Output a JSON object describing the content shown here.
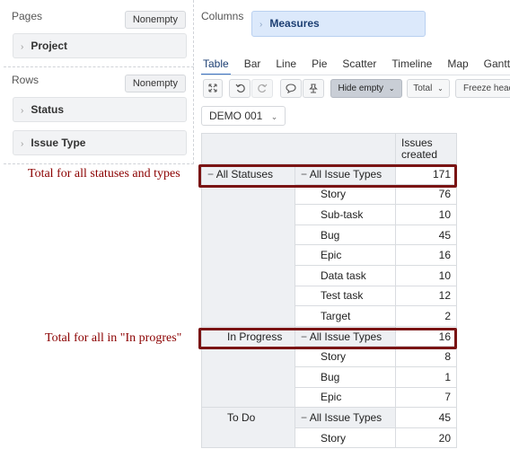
{
  "left": {
    "pages_label": "Pages",
    "pages_nonempty": "Nonempty",
    "pages_items": [
      "Project"
    ],
    "rows_label": "Rows",
    "rows_nonempty": "Nonempty",
    "rows_items": [
      "Status",
      "Issue Type"
    ]
  },
  "columns": {
    "label": "Columns",
    "measures": "Measures"
  },
  "tabs": [
    "Table",
    "Bar",
    "Line",
    "Pie",
    "Scatter",
    "Timeline",
    "Map",
    "Gantt"
  ],
  "active_tab": "Table",
  "toolbar": {
    "hide_empty": "Hide empty",
    "total": "Total",
    "freeze": "Freeze head"
  },
  "demo_select": "DEMO 001",
  "table": {
    "header_measure": "Issues created",
    "rows": [
      {
        "status": "All Statuses",
        "status_prefix": "−",
        "type": "All Issue Types",
        "type_prefix": "−",
        "value": "171"
      },
      {
        "status": "",
        "type": "Story",
        "value": "76"
      },
      {
        "status": "",
        "type": "Sub-task",
        "value": "10"
      },
      {
        "status": "",
        "type": "Bug",
        "value": "45"
      },
      {
        "status": "",
        "type": "Epic",
        "value": "16"
      },
      {
        "status": "",
        "type": "Data task",
        "value": "10"
      },
      {
        "status": "",
        "type": "Test task",
        "value": "12"
      },
      {
        "status": "",
        "type": "Target",
        "value": "2"
      },
      {
        "status": "In Progress",
        "type": "All Issue Types",
        "type_prefix": "−",
        "value": "16"
      },
      {
        "status": "",
        "type": "Story",
        "value": "8"
      },
      {
        "status": "",
        "type": "Bug",
        "value": "1"
      },
      {
        "status": "",
        "type": "Epic",
        "value": "7"
      },
      {
        "status": "To Do",
        "type": "All Issue Types",
        "type_prefix": "−",
        "value": "45"
      },
      {
        "status": "",
        "type": "Story",
        "value": "20"
      }
    ]
  },
  "annotations": {
    "total_all": "Total for all statuses and types",
    "total_in_progress": "Total for all in \"In progres\""
  },
  "colors": {
    "annotation": "#8b0000",
    "highlight_border": "#7a1414",
    "measures_bg": "#dce9fb",
    "active_tab": "#3b73c2"
  }
}
